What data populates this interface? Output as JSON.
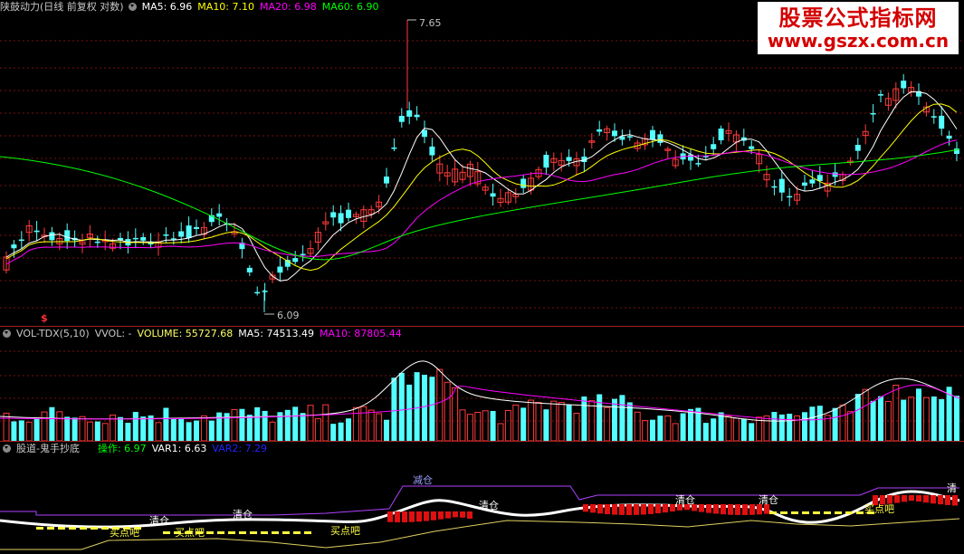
{
  "price_header": {
    "title": "陕鼓动力(日线 前复权 对数)",
    "ma5": "MA5: 6.96",
    "ma10": "MA10: 7.10",
    "ma20": "MA20: 6.98",
    "ma60": "MA60: 6.90"
  },
  "price_annotations": {
    "high": "7.65",
    "low": "6.09",
    "marker": "$"
  },
  "watermark": {
    "line1": "股票公式指标网",
    "line2": "www.gszx.com.cn"
  },
  "volume_header": {
    "title": "VOL-TDX(5,10)",
    "vvol": "VVOL: -",
    "volume": "VOLUME: 55727.68",
    "ma5": "MA5: 74513.49",
    "ma10": "MA10: 87805.44"
  },
  "indicator_header": {
    "title": "股道-鬼手抄底",
    "op": "操作: 6.97",
    "var1": "VAR1: 6.63",
    "var2": "VAR2: 7.29"
  },
  "indicator_labels": {
    "reduce": "减仓",
    "clear1": "清仓",
    "clear2": "清仓",
    "clear3": "清仓",
    "clear4": "清仓",
    "clear5": "清仓",
    "clear_edge": "清",
    "buy1": "买点吧",
    "buy2": "买点吧",
    "buy3": "买点吧",
    "buy4": "买点吧"
  },
  "colors": {
    "up": "#ff3b3b",
    "down": "#54ffff",
    "ma5": "#ffffff",
    "ma10": "#ffff00",
    "ma20": "#ff00ff",
    "ma60": "#00ff00",
    "grid": "#7a1010"
  }
}
